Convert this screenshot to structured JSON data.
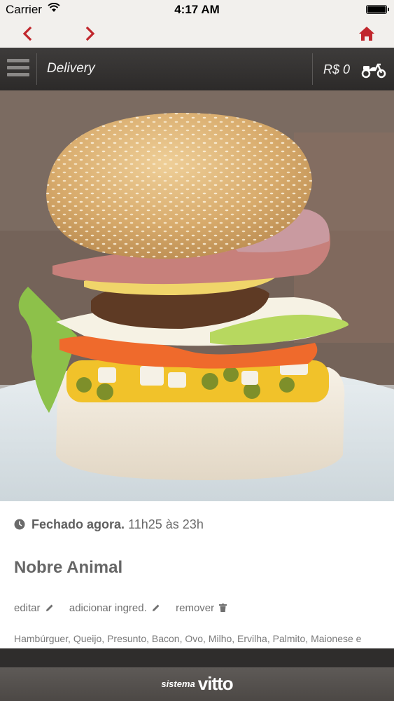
{
  "status_bar": {
    "carrier": "Carrier",
    "time": "4:17 AM"
  },
  "browser_nav": {
    "back_icon": "chevron-left",
    "forward_icon": "chevron-right",
    "home_icon": "home"
  },
  "header": {
    "title": "Delivery",
    "cart_total": "R$ 0",
    "delivery_icon": "scooter"
  },
  "product": {
    "hours_status": "Fechado agora.",
    "hours_range": "11h25 às 23h",
    "name": "Nobre Animal",
    "actions": {
      "edit": "editar",
      "add_ingredient": "adicionar ingred.",
      "remove": "remover"
    },
    "ingredients": "Hambúrguer, Queijo, Presunto, Bacon, Ovo, Milho, Ervilha, Palmito, Maionese e Salada"
  },
  "footer": {
    "brand_prefix": "sistema",
    "brand_name": "vitto"
  },
  "colors": {
    "accent": "#c1272d",
    "header_bg": "#353332",
    "footer_bg": "#55514e"
  }
}
